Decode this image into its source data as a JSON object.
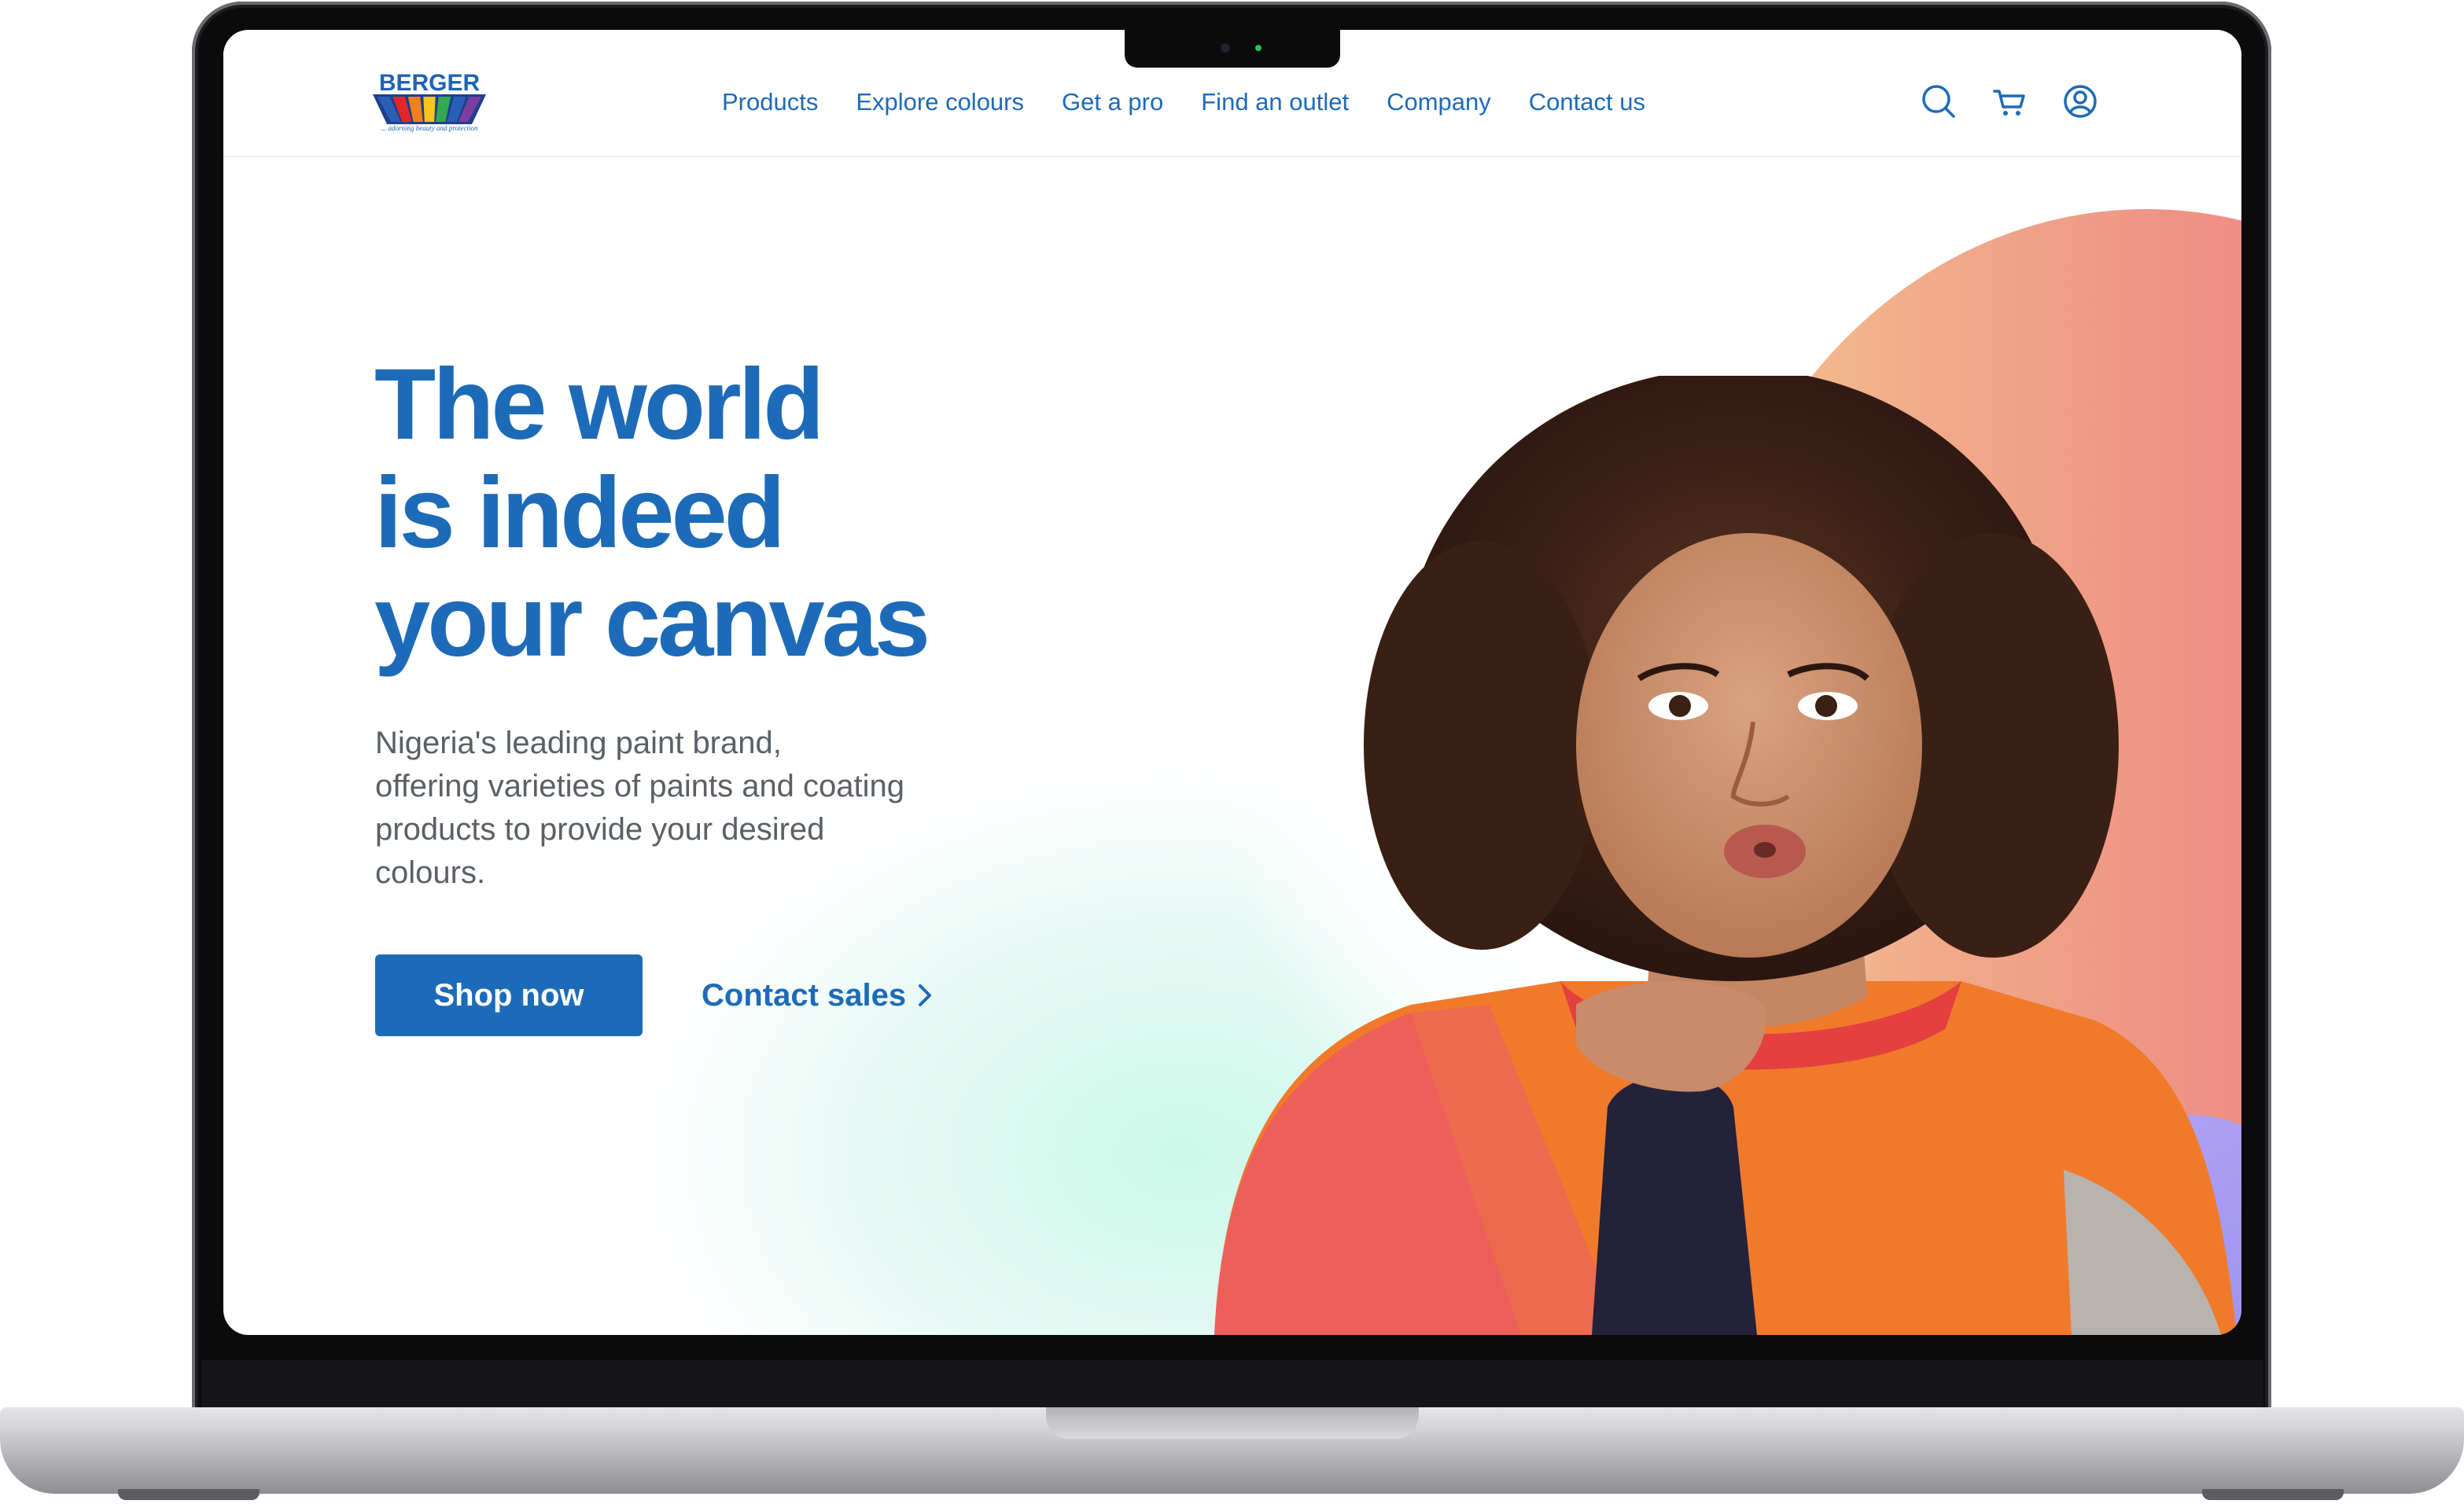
{
  "brand": {
    "name": "BERGER",
    "tagline": "... adorning beauty and protection",
    "stripe_colors": [
      "#2a5fb8",
      "#e3262d",
      "#f07f1e",
      "#f8c51c",
      "#34a853",
      "#2a5fb8",
      "#7b3fa0"
    ]
  },
  "nav": {
    "items": [
      {
        "label": "Products"
      },
      {
        "label": "Explore colours"
      },
      {
        "label": "Get a pro"
      },
      {
        "label": "Find an outlet"
      },
      {
        "label": "Company"
      },
      {
        "label": "Contact us"
      }
    ]
  },
  "header_icons": [
    "search-icon",
    "cart-icon",
    "account-icon"
  ],
  "hero": {
    "headline_lines": [
      "The world",
      "is indeed",
      "your canvas"
    ],
    "subtext_lines": [
      "Nigeria's leading paint brand,",
      "offering varieties of paints and coating",
      "products to provide your desired",
      "colours."
    ],
    "primary_cta": "Shop now",
    "secondary_cta": "Contact sales",
    "secondary_cta_icon": "chevron-right-icon"
  },
  "colors": {
    "accent": "#1d6bb8",
    "body_text": "#5b6066",
    "blob_warm_start": "#f2c48f",
    "blob_warm_end": "#ec6f86",
    "blob_purple": "#8f86ef",
    "glow_mint": "#c8f8e8"
  }
}
